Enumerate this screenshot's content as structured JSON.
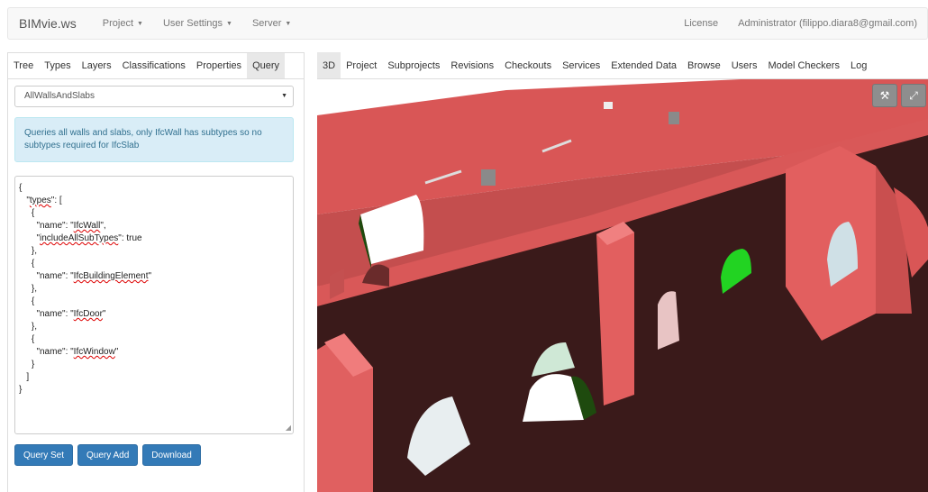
{
  "navbar": {
    "brand": "BIMvie.ws",
    "menus": [
      {
        "label": "Project"
      },
      {
        "label": "User Settings"
      },
      {
        "label": "Server"
      }
    ],
    "license": "License",
    "user": "Administrator (filippo.diara8@gmail.com)"
  },
  "left": {
    "tabs": [
      "Tree",
      "Types",
      "Layers",
      "Classifications",
      "Properties",
      "Query"
    ],
    "active_tab": "Query",
    "query_select": "AllWallsAndSlabs",
    "info": "Queries all walls and slabs, only IfcWall has subtypes so no subtypes required for IfcSlab",
    "buttons": {
      "query_set": "Query Set",
      "query_add": "Query Add",
      "download": "Download"
    }
  },
  "right": {
    "tabs": [
      "3D",
      "Project",
      "Subprojects",
      "Revisions",
      "Checkouts",
      "Services",
      "Extended Data",
      "Browse",
      "Users",
      "Model Checkers",
      "Log"
    ],
    "active_tab": "3D",
    "tools": [
      "wrench-icon",
      "expand-icon"
    ]
  },
  "colors": {
    "primary": "#337ab7",
    "info_bg": "#d9edf7",
    "wall_red": "#e25f5f",
    "wall_dark": "#3a1a1a",
    "door_green": "#2ed62e"
  }
}
